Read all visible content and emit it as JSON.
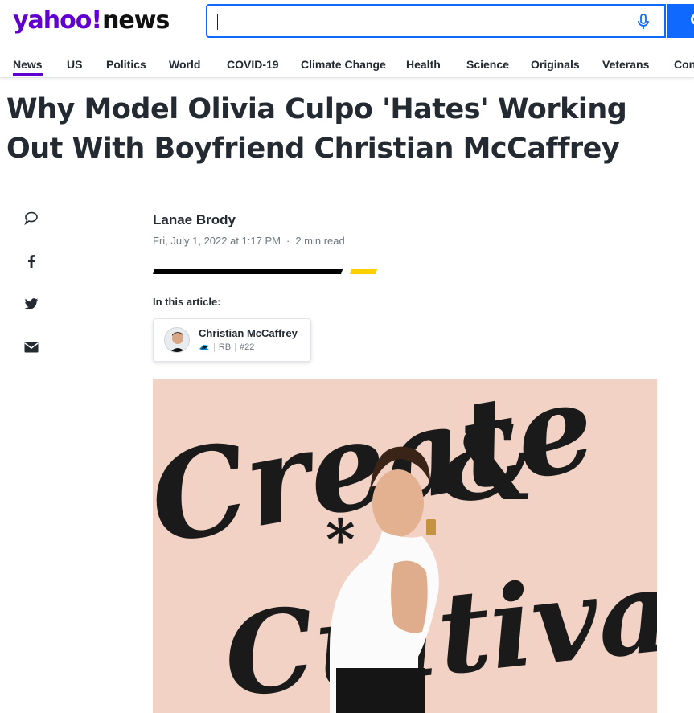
{
  "brand": {
    "logo_yahoo": "yahoo",
    "logo_bang": "!",
    "logo_news": "news",
    "brand_color": "#6001d2"
  },
  "search": {
    "value": "",
    "placeholder": "",
    "accent": "#0f69ff"
  },
  "nav": {
    "items": [
      "News",
      "US",
      "Politics",
      "World",
      "COVID-19",
      "Climate Change",
      "Health",
      "Science",
      "Originals",
      "Veterans",
      "Con"
    ],
    "active": "News"
  },
  "article": {
    "title": "Why Model Olivia Culpo 'Hates' Working Out With Boyfriend Christian McCaffrey",
    "author": "Lanae Brody",
    "date": "Fri, July 1, 2022 at 1:17 PM",
    "read_time": "2 min read",
    "separator": "·",
    "in_this_article_label": "In this article:"
  },
  "player": {
    "name": "Christian McCaffrey",
    "position": "RB",
    "number": "#22"
  },
  "share_icons": [
    "comment-icon",
    "facebook-icon",
    "twitter-icon",
    "mail-icon"
  ],
  "photo": {
    "backdrop_text_top": "Create",
    "backdrop_text_bottom": "Cultivate"
  }
}
